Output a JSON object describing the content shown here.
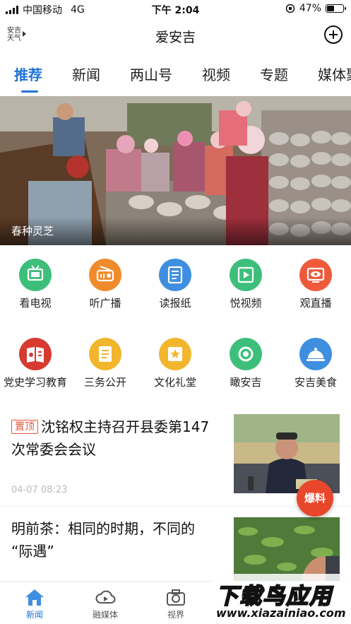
{
  "status_bar": {
    "carrier": "中国移动",
    "network": "4G",
    "time": "下午 2:04",
    "battery": "47%"
  },
  "header": {
    "weather_line1": "安吉",
    "weather_line2": "天气",
    "title": "爱安吉"
  },
  "tabs": [
    {
      "label": "推荐",
      "active": true
    },
    {
      "label": "新闻"
    },
    {
      "label": "两山号"
    },
    {
      "label": "视频"
    },
    {
      "label": "专题"
    },
    {
      "label": "媒体聚"
    }
  ],
  "banner": {
    "caption": "春种灵芝"
  },
  "grid": [
    {
      "label": "看电视",
      "icon": "tv-icon",
      "color": "#3dbf7b"
    },
    {
      "label": "听广播",
      "icon": "radio-icon",
      "color": "#f08b2c"
    },
    {
      "label": "读报纸",
      "icon": "newspaper-icon",
      "color": "#3f8fe0"
    },
    {
      "label": "悦视频",
      "icon": "video-icon",
      "color": "#3dbf7b"
    },
    {
      "label": "观直播",
      "icon": "live-eye-icon",
      "color": "#ef5a3b"
    },
    {
      "label": "党史学习教育",
      "icon": "party-book-icon",
      "color": "#d63a30"
    },
    {
      "label": "三务公开",
      "icon": "document-icon",
      "color": "#f2b62c"
    },
    {
      "label": "文化礼堂",
      "icon": "culture-hall-icon",
      "color": "#f2b62c"
    },
    {
      "label": "瞰安吉",
      "icon": "view-eye-icon",
      "color": "#3dbf7b"
    },
    {
      "label": "安吉美食",
      "icon": "food-cloche-icon",
      "color": "#3f8fe0"
    }
  ],
  "news": [
    {
      "tag": "置顶",
      "title_line1": "沈铭权主持召开县委第147",
      "title_line2": "次常委会会议",
      "time": "04-07 08:23"
    },
    {
      "title_line1": "明前茶：相同的时期，不同的",
      "title_line2": "“际遇”"
    }
  ],
  "floating_button": {
    "label": "爆料"
  },
  "bottom_nav": [
    {
      "label": "新闻",
      "icon": "home-icon",
      "active": true
    },
    {
      "label": "融媒体",
      "icon": "cloud-icon"
    },
    {
      "label": "视界",
      "icon": "camera-icon"
    }
  ],
  "watermark": {
    "title": "下载鸟应用",
    "url": "www.xiazainiao.com"
  },
  "colors": {
    "accent": "#1f74d8",
    "tag": "#e0563b",
    "baoliao": "#e8472c"
  }
}
